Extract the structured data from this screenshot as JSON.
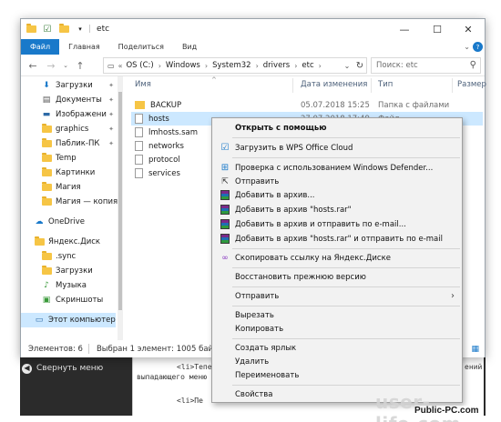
{
  "window": {
    "title": "etc",
    "ribbon_tabs": [
      "Файл",
      "Главная",
      "Поделиться",
      "Вид"
    ],
    "minimize": "—",
    "maximize": "☐",
    "close": "✕",
    "help": "?"
  },
  "address": {
    "crumbs": [
      "OS (C:)",
      "Windows",
      "System32",
      "drivers",
      "etc"
    ],
    "search_placeholder": "Поиск: etc"
  },
  "nav_pane": {
    "items": [
      {
        "label": "Загрузки",
        "icon": "download-icon",
        "pinned": true
      },
      {
        "label": "Документы",
        "icon": "documents-icon",
        "pinned": true
      },
      {
        "label": "Изображени",
        "icon": "pictures-icon",
        "pinned": true
      },
      {
        "label": "graphics",
        "icon": "folder-icon",
        "pinned": true
      },
      {
        "label": "Паблик-ПК",
        "icon": "folder-icon",
        "pinned": true
      },
      {
        "label": "Temp",
        "icon": "folder-icon",
        "pinned": false
      },
      {
        "label": "Картинки",
        "icon": "folder-icon",
        "pinned": false
      },
      {
        "label": "Магия",
        "icon": "folder-icon",
        "pinned": false
      },
      {
        "label": "Магия — копия",
        "icon": "folder-icon",
        "pinned": false
      },
      {
        "label": "OneDrive",
        "icon": "cloud-icon",
        "pinned": false
      },
      {
        "label": "Яндекс.Диск",
        "icon": "yandex-disk-icon",
        "pinned": false
      },
      {
        "label": ".sync",
        "icon": "folder-icon",
        "pinned": false
      },
      {
        "label": "Загрузки",
        "icon": "folder-icon",
        "pinned": false
      },
      {
        "label": "Музыка",
        "icon": "music-folder-icon",
        "pinned": false
      },
      {
        "label": "Скриншоты",
        "icon": "screenshots-folder-icon",
        "pinned": false
      },
      {
        "label": "Этот компьютер",
        "icon": "computer-icon",
        "pinned": false
      }
    ]
  },
  "columns": {
    "name": "Имя",
    "date": "Дата изменения",
    "type": "Тип",
    "size": "Размер"
  },
  "files": [
    {
      "name": "BACKUP",
      "date": "05.07.2018 15:25",
      "type": "Папка с файлами",
      "folder": true
    },
    {
      "name": "hosts",
      "date": "27.07.2018 17:49",
      "type": "Файл",
      "folder": false
    },
    {
      "name": "lmhosts.sam",
      "date": "",
      "type": "",
      "folder": false
    },
    {
      "name": "networks",
      "date": "",
      "type": "",
      "folder": false
    },
    {
      "name": "protocol",
      "date": "",
      "type": "",
      "folder": false
    },
    {
      "name": "services",
      "date": "",
      "type": "",
      "folder": false
    }
  ],
  "status": {
    "count": "Элементов: 6",
    "selected": "Выбран 1 элемент: 1005 байт"
  },
  "context_menu": {
    "items": [
      {
        "label": "Открыть с помощью",
        "icon": "",
        "bold": true
      },
      {
        "label": "Загрузить в WPS Office Cloud",
        "icon": "wps-cloud-icon"
      },
      {
        "label": "Проверка с использованием Windows Defender...",
        "icon": "defender-icon"
      },
      {
        "label": "Отправить",
        "icon": "share-icon"
      },
      {
        "label": "Добавить в архив...",
        "icon": "winrar-icon"
      },
      {
        "label": "Добавить в архив \"hosts.rar\"",
        "icon": "winrar-icon"
      },
      {
        "label": "Добавить в архив и отправить по e-mail...",
        "icon": "winrar-icon"
      },
      {
        "label": "Добавить в архив \"hosts.rar\" и отправить по e-mail",
        "icon": "winrar-icon"
      },
      {
        "label": "Скопировать ссылку на Яндекс.Диске",
        "icon": "link-icon"
      },
      {
        "label": "Восстановить прежнюю версию",
        "icon": ""
      },
      {
        "label": "Отправить",
        "icon": "",
        "submenu": true
      },
      {
        "label": "Вырезать",
        "icon": ""
      },
      {
        "label": "Копировать",
        "icon": ""
      },
      {
        "label": "Создать ярлык",
        "icon": ""
      },
      {
        "label": "Удалить",
        "icon": ""
      },
      {
        "label": "Переименовать",
        "icon": ""
      },
      {
        "label": "Свойства",
        "icon": ""
      }
    ]
  },
  "background": {
    "collapse_menu": "Свернуть меню",
    "code_line1": "<li>Тепе",
    "code_line2": "выпадающего меню",
    "code_line3": "<li>Пе",
    "code_right": "ений"
  },
  "watermarks": {
    "site1": "user-life.com",
    "site2": "Public-PC.com"
  }
}
